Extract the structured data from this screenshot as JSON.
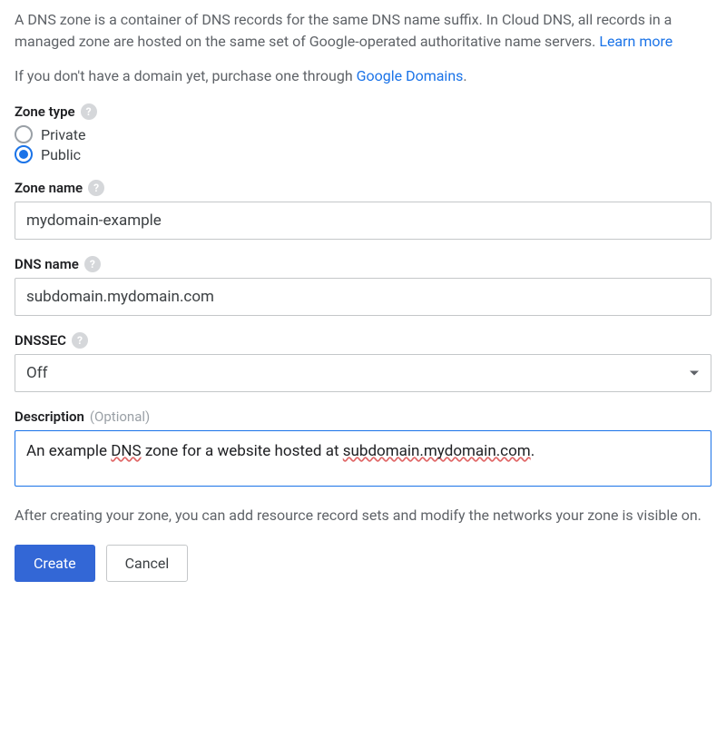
{
  "intro": {
    "text_prefix": "A DNS zone is a container of DNS records for the same DNS name suffix. In Cloud DNS, all records in a managed zone are hosted on the same set of Google-operated authoritative name servers. ",
    "learn_more": "Learn more"
  },
  "domain_prompt": {
    "text_prefix": "If you don't have a domain yet, purchase one through ",
    "link": "Google Domains",
    "suffix": "."
  },
  "zone_type": {
    "label": "Zone type",
    "options": {
      "private": "Private",
      "public": "Public"
    },
    "selected": "public"
  },
  "zone_name": {
    "label": "Zone name",
    "value": "mydomain-example"
  },
  "dns_name": {
    "label": "DNS name",
    "value": "subdomain.mydomain.com"
  },
  "dnssec": {
    "label": "DNSSEC",
    "value": "Off"
  },
  "description": {
    "label": "Description",
    "optional_text": "(Optional)",
    "value_prefix": "An example ",
    "value_spell1": "DNS",
    "value_mid": " zone for a website hosted at ",
    "value_spell2": "subdomain.mydomain.com",
    "value_suffix": "."
  },
  "post_create_text": "After creating your zone, you can add resource record sets and modify the networks your zone is visible on.",
  "buttons": {
    "create": "Create",
    "cancel": "Cancel"
  },
  "help_glyph": "?"
}
